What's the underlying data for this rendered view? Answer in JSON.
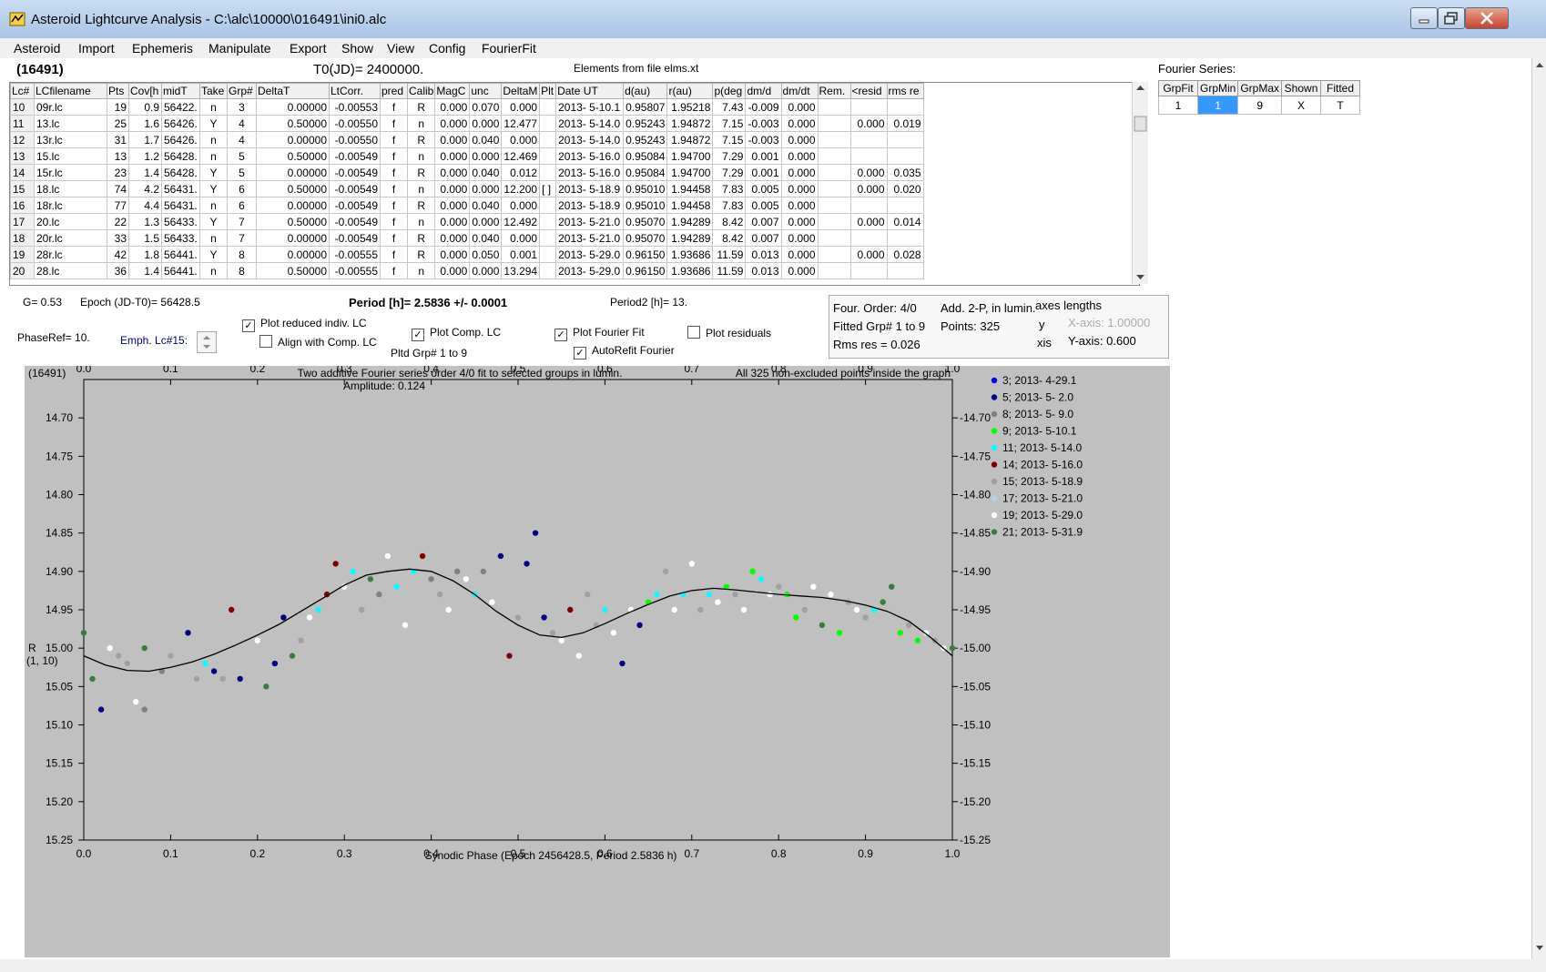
{
  "window": {
    "title": "Asteroid Lightcurve Analysis - C:\\alc\\10000\\016491\\ini0.alc"
  },
  "menu": [
    "Asteroid",
    "Import",
    "Ephemeris",
    "Manipulate",
    "Export",
    "Show",
    "View",
    "Config",
    "FourierFit"
  ],
  "header": {
    "asteroid": "(16491)",
    "t0": "T0(JD)= 2400000.",
    "elements": "Elements from file elms.xt"
  },
  "lc_table": {
    "columns": [
      "Lc#",
      "LCfilename",
      "Pts",
      "Cov[h",
      "midT",
      "Take",
      "Grp#",
      "DeltaT",
      "LtCorr.",
      "pred",
      "Calib",
      "MagC",
      "unc",
      "DeltaM",
      "Plt",
      "Date UT",
      "d(au)",
      "r(au)",
      "p(deg",
      "dm/d",
      "dm/dt",
      "Rem.",
      "<resid",
      "rms re"
    ],
    "rows": [
      [
        "10",
        "09r.lc",
        "19",
        "0.9",
        "56422.",
        "n",
        "3",
        "0.00000",
        "-0.00553",
        "f",
        "R",
        "0.000",
        "0.070",
        "0.000",
        "",
        "2013- 5-10.1",
        "0.95807",
        "1.95218",
        "7.43",
        "-0.009",
        "0.000",
        "",
        "",
        ""
      ],
      [
        "11",
        "13.lc",
        "25",
        "1.6",
        "56426.",
        "Y",
        "4",
        "0.50000",
        "-0.00550",
        "f",
        "n",
        "0.000",
        "0.000",
        "12.477",
        "",
        "2013- 5-14.0",
        "0.95243",
        "1.94872",
        "7.15",
        "-0.003",
        "0.000",
        "",
        "0.000",
        "0.019"
      ],
      [
        "12",
        "13r.lc",
        "31",
        "1.7",
        "56426.",
        "n",
        "4",
        "0.00000",
        "-0.00550",
        "f",
        "R",
        "0.000",
        "0.040",
        "0.000",
        "",
        "2013- 5-14.0",
        "0.95243",
        "1.94872",
        "7.15",
        "-0.003",
        "0.000",
        "",
        "",
        ""
      ],
      [
        "13",
        "15.lc",
        "13",
        "1.2",
        "56428.",
        "n",
        "5",
        "0.50000",
        "-0.00549",
        "f",
        "n",
        "0.000",
        "0.000",
        "12.469",
        "",
        "2013- 5-16.0",
        "0.95084",
        "1.94700",
        "7.29",
        "0.001",
        "0.000",
        "",
        "",
        ""
      ],
      [
        "14",
        "15r.lc",
        "23",
        "1.4",
        "56428.",
        "Y",
        "5",
        "0.00000",
        "-0.00549",
        "f",
        "R",
        "0.000",
        "0.040",
        "0.012",
        "",
        "2013- 5-16.0",
        "0.95084",
        "1.94700",
        "7.29",
        "0.001",
        "0.000",
        "",
        "0.000",
        "0.035"
      ],
      [
        "15",
        "18.lc",
        "74",
        "4.2",
        "56431.",
        "Y",
        "6",
        "0.50000",
        "-0.00549",
        "f",
        "n",
        "0.000",
        "0.000",
        "12.200",
        "[ ]",
        "2013- 5-18.9",
        "0.95010",
        "1.94458",
        "7.83",
        "0.005",
        "0.000",
        "",
        "0.000",
        "0.020"
      ],
      [
        "16",
        "18r.lc",
        "77",
        "4.4",
        "56431.",
        "n",
        "6",
        "0.00000",
        "-0.00549",
        "f",
        "R",
        "0.000",
        "0.040",
        "0.000",
        "",
        "2013- 5-18.9",
        "0.95010",
        "1.94458",
        "7.83",
        "0.005",
        "0.000",
        "",
        "",
        ""
      ],
      [
        "17",
        "20.lc",
        "22",
        "1.3",
        "56433.",
        "Y",
        "7",
        "0.50000",
        "-0.00549",
        "f",
        "n",
        "0.000",
        "0.000",
        "12.492",
        "",
        "2013- 5-21.0",
        "0.95070",
        "1.94289",
        "8.42",
        "0.007",
        "0.000",
        "",
        "0.000",
        "0.014"
      ],
      [
        "18",
        "20r.lc",
        "33",
        "1.5",
        "56433.",
        "n",
        "7",
        "0.00000",
        "-0.00549",
        "f",
        "R",
        "0.000",
        "0.040",
        "0.000",
        "",
        "2013- 5-21.0",
        "0.95070",
        "1.94289",
        "8.42",
        "0.007",
        "0.000",
        "",
        "",
        ""
      ],
      [
        "19",
        "28r.lc",
        "42",
        "1.8",
        "56441.",
        "Y",
        "8",
        "0.00000",
        "-0.00555",
        "f",
        "R",
        "0.000",
        "0.050",
        "0.001",
        "",
        "2013- 5-29.0",
        "0.96150",
        "1.93686",
        "11.59",
        "0.013",
        "0.000",
        "",
        "0.000",
        "0.028"
      ],
      [
        "20",
        "28.lc",
        "36",
        "1.4",
        "56441.",
        "n",
        "8",
        "0.50000",
        "-0.00555",
        "f",
        "n",
        "0.000",
        "0.000",
        "13.294",
        "",
        "2013- 5-29.0",
        "0.96150",
        "1.93686",
        "11.59",
        "0.013",
        "0.000",
        "",
        "",
        ""
      ]
    ]
  },
  "fourier_series": {
    "label": "Fourier Series:",
    "columns": [
      "GrpFit",
      "GrpMin",
      "GrpMax",
      "Shown",
      "Fitted"
    ],
    "row": [
      "1",
      "1",
      "9",
      "X",
      "T"
    ]
  },
  "controls": {
    "g": "G= 0.53",
    "epoch": "Epoch (JD-T0)= 56428.5",
    "period": "Period [h]= 2.5836 +/- 0.0001",
    "period2": "Period2 [h]= 13.",
    "phaseref": "PhaseRef= 10.",
    "emph": "Emph. Lc#15:",
    "plot_reduced": "Plot reduced indiv. LC",
    "align_comp": "Align with Comp. LC",
    "plot_comp": "Plot Comp. LC",
    "pltd_grp": "Pltd Grp#  1   to    9",
    "plot_fourier": "Plot Fourier Fit",
    "autorefit": "AutoRefit Fourier",
    "plot_residuals": "Plot residuals"
  },
  "info": {
    "four_order": "Four. Order:  4/0",
    "add2p": "Add. 2-P, in lumin.",
    "fitted_grp": "Fitted Grp# 1 to 9",
    "points": "Points: 325",
    "rms": "Rms res     = 0.026",
    "axes_lengths": "axes lengths",
    "y": "y",
    "xis": "xis",
    "xaxis": "X-axis:   1.00000",
    "yaxis": "Y-axis:   0.600"
  },
  "chart_data": {
    "type": "scatter",
    "corner_label": "(16491)",
    "title": "Two additive Fourier series order 4/0 fit to selected groups in lumin.",
    "subtitle": "Amplitude: 0.124",
    "note": "All 325 non-excluded points inside the graph",
    "xlabel": "Synodic Phase (Epoch 2456428.5, Period 2.5836 h)",
    "ylabel": "R",
    "ylabel2": "(1, 10)",
    "xlim": [
      0,
      1
    ],
    "ylim": [
      15.25,
      14.65
    ],
    "xticks": [
      "0.0",
      "0.1",
      "0.2",
      "0.3",
      "0.4",
      "0.5",
      "0.6",
      "0.7",
      "0.8",
      "0.9",
      "1.0"
    ],
    "yticks": [
      "14.70",
      "14.75",
      "14.80",
      "14.85",
      "14.90",
      "14.95",
      "15.00",
      "15.05",
      "15.10",
      "15.15",
      "15.20",
      "15.25"
    ],
    "legend": [
      {
        "label": "3; 2013- 4-29.1",
        "color": "#0000ff"
      },
      {
        "label": "5; 2013- 5- 2.0",
        "color": "#000080"
      },
      {
        "label": "8; 2013- 5- 9.0",
        "color": "#808080"
      },
      {
        "label": "9; 2013- 5-10.1",
        "color": "#00ff00"
      },
      {
        "label": "11; 2013- 5-14.0",
        "color": "#00ffff"
      },
      {
        "label": "14; 2013- 5-16.0",
        "color": "#800000"
      },
      {
        "label": "15; 2013- 5-18.9",
        "color": "#a0a0a0"
      },
      {
        "label": "17; 2013- 5-21.0",
        "color": "#add8e6"
      },
      {
        "label": "19; 2013- 5-29.0",
        "color": "#ffffff"
      },
      {
        "label": "21; 2013- 5-31.9",
        "color": "#3a7d3a"
      }
    ],
    "fit_curve": {
      "x": [
        0.0,
        0.025,
        0.05,
        0.075,
        0.1,
        0.125,
        0.15,
        0.175,
        0.2,
        0.225,
        0.25,
        0.275,
        0.3,
        0.325,
        0.35,
        0.375,
        0.4,
        0.425,
        0.45,
        0.475,
        0.5,
        0.525,
        0.55,
        0.575,
        0.6,
        0.625,
        0.65,
        0.675,
        0.7,
        0.725,
        0.75,
        0.775,
        0.8,
        0.825,
        0.85,
        0.875,
        0.9,
        0.925,
        0.95,
        0.975,
        1.0
      ],
      "y": [
        15.01,
        15.022,
        15.029,
        15.03,
        15.025,
        15.018,
        15.008,
        14.996,
        14.983,
        14.969,
        14.952,
        14.935,
        14.918,
        14.905,
        14.9,
        14.897,
        14.9,
        14.912,
        14.93,
        14.952,
        14.97,
        14.983,
        14.986,
        14.98,
        14.968,
        14.955,
        14.943,
        14.932,
        14.925,
        14.922,
        14.924,
        14.927,
        14.93,
        14.932,
        14.934,
        14.938,
        14.944,
        14.952,
        14.965,
        14.986,
        15.01
      ]
    },
    "points": [
      {
        "x": 0.02,
        "y": 15.08,
        "g": 1
      },
      {
        "x": 0.04,
        "y": 15.01,
        "g": 6
      },
      {
        "x": 0.06,
        "y": 15.07,
        "g": 8
      },
      {
        "x": 0.07,
        "y": 15.08,
        "g": 2
      },
      {
        "x": 0.0,
        "y": 14.98,
        "g": 9
      },
      {
        "x": 0.01,
        "y": 15.04,
        "g": 9
      },
      {
        "x": 0.03,
        "y": 15.0,
        "g": 8
      },
      {
        "x": 0.05,
        "y": 15.02,
        "g": 6
      },
      {
        "x": 0.07,
        "y": 15.0,
        "g": 9
      },
      {
        "x": 0.09,
        "y": 15.03,
        "g": 2
      },
      {
        "x": 0.1,
        "y": 15.01,
        "g": 6
      },
      {
        "x": 0.12,
        "y": 14.98,
        "g": 1
      },
      {
        "x": 0.13,
        "y": 15.04,
        "g": 6
      },
      {
        "x": 0.14,
        "y": 15.02,
        "g": 4
      },
      {
        "x": 0.15,
        "y": 15.03,
        "g": 1
      },
      {
        "x": 0.16,
        "y": 15.04,
        "g": 6
      },
      {
        "x": 0.17,
        "y": 14.95,
        "g": 5
      },
      {
        "x": 0.18,
        "y": 15.04,
        "g": 1
      },
      {
        "x": 0.2,
        "y": 14.99,
        "g": 8
      },
      {
        "x": 0.21,
        "y": 15.05,
        "g": 9
      },
      {
        "x": 0.22,
        "y": 15.02,
        "g": 1
      },
      {
        "x": 0.23,
        "y": 14.96,
        "g": 1
      },
      {
        "x": 0.24,
        "y": 15.01,
        "g": 9
      },
      {
        "x": 0.25,
        "y": 14.99,
        "g": 6
      },
      {
        "x": 0.26,
        "y": 14.96,
        "g": 8
      },
      {
        "x": 0.27,
        "y": 14.95,
        "g": 4
      },
      {
        "x": 0.28,
        "y": 14.93,
        "g": 5
      },
      {
        "x": 0.29,
        "y": 14.89,
        "g": 5
      },
      {
        "x": 0.3,
        "y": 14.92,
        "g": 8
      },
      {
        "x": 0.31,
        "y": 14.9,
        "g": 4
      },
      {
        "x": 0.32,
        "y": 14.95,
        "g": 6
      },
      {
        "x": 0.33,
        "y": 14.91,
        "g": 9
      },
      {
        "x": 0.34,
        "y": 14.93,
        "g": 2
      },
      {
        "x": 0.35,
        "y": 14.88,
        "g": 8
      },
      {
        "x": 0.36,
        "y": 14.92,
        "g": 4
      },
      {
        "x": 0.37,
        "y": 14.97,
        "g": 8
      },
      {
        "x": 0.38,
        "y": 14.9,
        "g": 4
      },
      {
        "x": 0.39,
        "y": 14.88,
        "g": 5
      },
      {
        "x": 0.4,
        "y": 14.91,
        "g": 2
      },
      {
        "x": 0.41,
        "y": 14.93,
        "g": 6
      },
      {
        "x": 0.42,
        "y": 14.95,
        "g": 8
      },
      {
        "x": 0.43,
        "y": 14.9,
        "g": 2
      },
      {
        "x": 0.44,
        "y": 14.91,
        "g": 8
      },
      {
        "x": 0.45,
        "y": 14.93,
        "g": 4
      },
      {
        "x": 0.46,
        "y": 14.9,
        "g": 2
      },
      {
        "x": 0.47,
        "y": 14.94,
        "g": 8
      },
      {
        "x": 0.48,
        "y": 14.88,
        "g": 1
      },
      {
        "x": 0.49,
        "y": 15.01,
        "g": 5
      },
      {
        "x": 0.5,
        "y": 14.96,
        "g": 6
      },
      {
        "x": 0.51,
        "y": 14.89,
        "g": 1
      },
      {
        "x": 0.52,
        "y": 14.85,
        "g": 1
      },
      {
        "x": 0.53,
        "y": 14.96,
        "g": 1
      },
      {
        "x": 0.54,
        "y": 14.98,
        "g": 6
      },
      {
        "x": 0.55,
        "y": 14.99,
        "g": 8
      },
      {
        "x": 0.56,
        "y": 14.95,
        "g": 5
      },
      {
        "x": 0.57,
        "y": 15.01,
        "g": 8
      },
      {
        "x": 0.58,
        "y": 14.93,
        "g": 6
      },
      {
        "x": 0.59,
        "y": 14.97,
        "g": 6
      },
      {
        "x": 0.6,
        "y": 14.95,
        "g": 4
      },
      {
        "x": 0.61,
        "y": 14.98,
        "g": 8
      },
      {
        "x": 0.62,
        "y": 15.02,
        "g": 1
      },
      {
        "x": 0.63,
        "y": 14.95,
        "g": 8
      },
      {
        "x": 0.64,
        "y": 14.97,
        "g": 1
      },
      {
        "x": 0.65,
        "y": 14.94,
        "g": 3
      },
      {
        "x": 0.66,
        "y": 14.93,
        "g": 4
      },
      {
        "x": 0.67,
        "y": 14.9,
        "g": 6
      },
      {
        "x": 0.68,
        "y": 14.95,
        "g": 8
      },
      {
        "x": 0.69,
        "y": 14.93,
        "g": 4
      },
      {
        "x": 0.7,
        "y": 14.89,
        "g": 8
      },
      {
        "x": 0.71,
        "y": 14.95,
        "g": 6
      },
      {
        "x": 0.72,
        "y": 14.93,
        "g": 4
      },
      {
        "x": 0.73,
        "y": 14.94,
        "g": 8
      },
      {
        "x": 0.74,
        "y": 14.92,
        "g": 3
      },
      {
        "x": 0.75,
        "y": 14.93,
        "g": 6
      },
      {
        "x": 0.76,
        "y": 14.95,
        "g": 8
      },
      {
        "x": 0.77,
        "y": 14.9,
        "g": 3
      },
      {
        "x": 0.78,
        "y": 14.91,
        "g": 4
      },
      {
        "x": 0.79,
        "y": 14.93,
        "g": 8
      },
      {
        "x": 0.8,
        "y": 14.92,
        "g": 6
      },
      {
        "x": 0.81,
        "y": 14.93,
        "g": 3
      },
      {
        "x": 0.82,
        "y": 14.96,
        "g": 3
      },
      {
        "x": 0.83,
        "y": 14.95,
        "g": 6
      },
      {
        "x": 0.84,
        "y": 14.92,
        "g": 8
      },
      {
        "x": 0.85,
        "y": 14.97,
        "g": 9
      },
      {
        "x": 0.86,
        "y": 14.93,
        "g": 8
      },
      {
        "x": 0.87,
        "y": 14.98,
        "g": 3
      },
      {
        "x": 0.88,
        "y": 14.94,
        "g": 6
      },
      {
        "x": 0.89,
        "y": 14.95,
        "g": 8
      },
      {
        "x": 0.9,
        "y": 14.96,
        "g": 6
      },
      {
        "x": 0.91,
        "y": 14.95,
        "g": 4
      },
      {
        "x": 0.92,
        "y": 14.94,
        "g": 9
      },
      {
        "x": 0.93,
        "y": 14.92,
        "g": 9
      },
      {
        "x": 0.94,
        "y": 14.98,
        "g": 3
      },
      {
        "x": 0.95,
        "y": 14.97,
        "g": 6
      },
      {
        "x": 0.96,
        "y": 14.99,
        "g": 3
      },
      {
        "x": 0.97,
        "y": 14.98,
        "g": 8
      },
      {
        "x": 0.98,
        "y": 14.99,
        "g": 6
      },
      {
        "x": 0.99,
        "y": 15.0,
        "g": 8
      },
      {
        "x": 1.0,
        "y": 15.0,
        "g": 9
      }
    ]
  }
}
